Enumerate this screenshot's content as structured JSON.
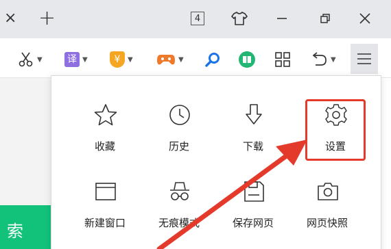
{
  "tabbar": {
    "close_glyph": "×",
    "new_glyph": "+",
    "tab_count": "4"
  },
  "toolbar": {
    "icons": [
      "scissors-icon",
      "translate-icon",
      "coupon-icon",
      "game-icon",
      "search-icon",
      "reader-icon",
      "apps-grid-icon",
      "undo-icon",
      "menu-icon"
    ],
    "translate_glyph": "译",
    "coupon_glyph": "¥"
  },
  "page": {
    "green_button_text": "索"
  },
  "menu": {
    "items": [
      {
        "label": "收藏",
        "icon": "star-icon"
      },
      {
        "label": "历史",
        "icon": "clock-icon"
      },
      {
        "label": "下载",
        "icon": "download-icon"
      },
      {
        "label": "设置",
        "icon": "gear-icon"
      },
      {
        "label": "新建窗口",
        "icon": "new-window-icon"
      },
      {
        "label": "无痕模式",
        "icon": "incognito-icon"
      },
      {
        "label": "保存网页",
        "icon": "save-page-icon"
      },
      {
        "label": "网页快照",
        "icon": "camera-icon"
      }
    ],
    "highlighted": "设置"
  },
  "colors": {
    "highlight": "#e33a2b",
    "accent_green": "#12c27b",
    "search_blue": "#1a73e8"
  }
}
